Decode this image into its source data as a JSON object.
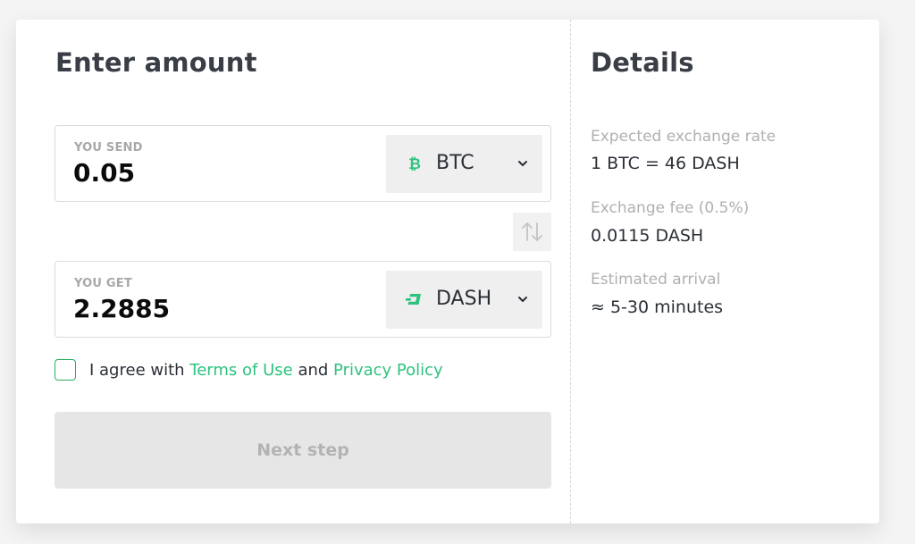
{
  "form": {
    "title": "Enter amount",
    "send": {
      "label": "YOU SEND",
      "value": "0.05",
      "currency": "BTC",
      "currency_icon": "bitcoin-icon",
      "currency_color": "#2ec27e"
    },
    "get": {
      "label": "YOU GET",
      "value": "2.2885",
      "currency": "DASH",
      "currency_icon": "dash-icon",
      "currency_color": "#2ec27e"
    },
    "swap_icon": "swap-arrows-icon",
    "agree": {
      "checked": false,
      "prefix": "I agree with ",
      "terms_link": "Terms of Use",
      "middle": " and ",
      "privacy_link": "Privacy Policy",
      "link_color": "#2ec27e"
    },
    "next_button": "Next step",
    "next_enabled": false
  },
  "details": {
    "title": "Details",
    "items": [
      {
        "label": "Expected exchange rate",
        "value": "1 BTC = 46 DASH"
      },
      {
        "label": "Exchange fee (0.5%)",
        "value": "0.0115 DASH"
      },
      {
        "label": "Estimated arrival",
        "value": "≈ 5-30 minutes"
      }
    ]
  }
}
